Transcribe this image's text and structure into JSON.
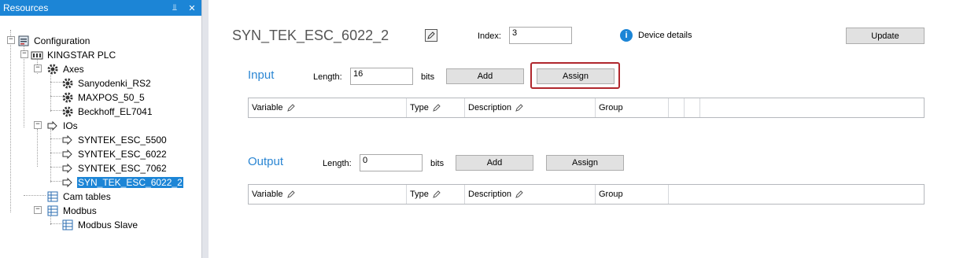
{
  "panel": {
    "title": "Resources",
    "pin_glyph": "⫫",
    "close_glyph": "✕"
  },
  "tree": {
    "root": "Configuration",
    "plc": "KINGSTAR PLC",
    "axes": "Axes",
    "axis_items": [
      "Sanyodenki_RS2",
      "MAXPOS_50_5",
      "Beckhoff_EL7041"
    ],
    "ios": "IOs",
    "io_items": [
      "SYNTEK_ESC_5500",
      "SYNTEK_ESC_6022",
      "SYNTEK_ESC_7062",
      "SYN_TEK_ESC_6022_2"
    ],
    "cam_tables": "Cam tables",
    "modbus": "Modbus",
    "modbus_slave": "Modbus Slave",
    "expand_glyph": "−",
    "selected": "SYN_TEK_ESC_6022_2"
  },
  "device": {
    "name": "SYN_TEK_ESC_6022_2",
    "index_label": "Index:",
    "index_value": "3",
    "details_label": "Device details",
    "info_glyph": "i",
    "update_label": "Update"
  },
  "input": {
    "title": "Input",
    "length_label": "Length:",
    "length_value": "16",
    "bits_label": "bits",
    "add_label": "Add",
    "assign_label": "Assign",
    "highlight_color": "#b0272d"
  },
  "output": {
    "title": "Output",
    "length_label": "Length:",
    "length_value": "0",
    "bits_label": "bits",
    "add_label": "Add",
    "assign_label": "Assign"
  },
  "columns": [
    "Variable",
    "Type",
    "Description",
    "Group"
  ],
  "colors": {
    "accent": "#1c85d6",
    "section_title": "#2b86d3"
  }
}
